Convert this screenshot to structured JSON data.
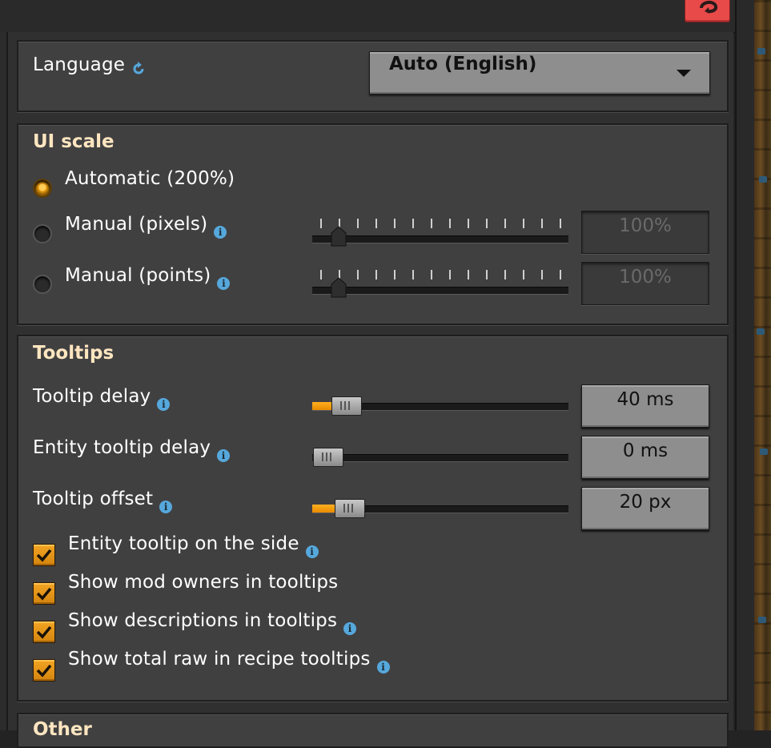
{
  "language": {
    "label": "Language",
    "value": "Auto (English)"
  },
  "ui_scale": {
    "heading": "UI scale",
    "automatic_label": "Automatic (200%)",
    "manual_pixels_label": "Manual (pixels)",
    "manual_pixels_value": "100%",
    "manual_points_label": "Manual (points)",
    "manual_points_value": "100%",
    "selected": "automatic"
  },
  "tooltips": {
    "heading": "Tooltips",
    "tooltip_delay_label": "Tooltip delay",
    "tooltip_delay_value": "40 ms",
    "entity_tooltip_delay_label": "Entity tooltip delay",
    "entity_tooltip_delay_value": "0 ms",
    "tooltip_offset_label": "Tooltip offset",
    "tooltip_offset_value": "20 px",
    "checkboxes": [
      {
        "label": "Entity tooltip on the side",
        "checked": true
      },
      {
        "label": "Show mod owners in tooltips",
        "checked": true
      },
      {
        "label": "Show descriptions in tooltips",
        "checked": true
      },
      {
        "label": "Show total raw in recipe tooltips",
        "checked": true
      }
    ]
  },
  "other": {
    "heading": "Other"
  },
  "icons": {
    "info": "info-icon",
    "reset": "reset-icon",
    "close": "close-icon",
    "checkmark": "checkmark-icon",
    "dropdown": "chevron-down-icon"
  },
  "colors": {
    "accent": "#e89a10",
    "heading": "#ffe6c0",
    "info": "#56a8dc",
    "close": "#e84a4a"
  }
}
